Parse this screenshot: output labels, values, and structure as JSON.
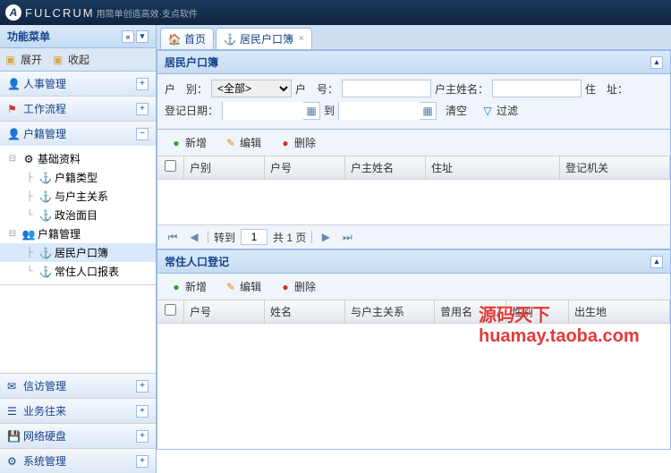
{
  "app": {
    "name": "FULCRUM",
    "slogan": "用简单创造高效·支点软件"
  },
  "sidebar": {
    "title": "功能菜单",
    "expand": "展开",
    "collapse": "收起",
    "sections": {
      "hr": "人事管理",
      "workflow": "工作流程",
      "household": "户籍管理",
      "petition": "信访管理",
      "business": "业务往来",
      "netdisk": "网络硬盘",
      "system": "系统管理"
    },
    "tree": {
      "base": "基础资料",
      "type": "户籍类型",
      "relation": "与户主关系",
      "politics": "政治面目",
      "mgmt": "户籍管理",
      "book": "居民户口簿",
      "report": "常住人口报表"
    }
  },
  "tabs": {
    "home": "首页",
    "book": "居民户口簿"
  },
  "panel1": {
    "title": "居民户口簿",
    "form": {
      "type": "户　别：",
      "typeAll": "<全部>",
      "num": "户　号：",
      "head": "户主姓名：",
      "addr": "住　址：",
      "regdate": "登记日期：",
      "to": "到",
      "clear": "清空",
      "filter": "过滤"
    },
    "toolbar": {
      "add": "新增",
      "edit": "编辑",
      "del": "删除"
    },
    "cols": {
      "c1": "户别",
      "c2": "户号",
      "c3": "户主姓名",
      "c4": "住址",
      "c5": "登记机关"
    },
    "pager": {
      "goto": "转到",
      "page": "1",
      "total": "共 1 页"
    }
  },
  "panel2": {
    "title": "常住人口登记",
    "toolbar": {
      "add": "新增",
      "edit": "编辑",
      "del": "删除"
    },
    "cols": {
      "c1": "户号",
      "c2": "姓名",
      "c3": "与户主关系",
      "c4": "曾用名",
      "c5": "性别",
      "c6": "出生地"
    }
  },
  "watermark": "源码天下huamay.taoba.com"
}
